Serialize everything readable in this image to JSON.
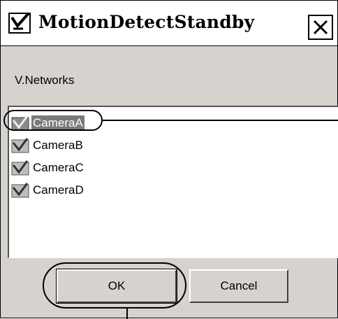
{
  "window": {
    "title": "MotionDetectStandby"
  },
  "section_label": "V.Networks",
  "cameras": [
    {
      "label": "CameraA",
      "selected": true
    },
    {
      "label": "CameraB",
      "selected": false
    },
    {
      "label": "CameraC",
      "selected": false
    },
    {
      "label": "CameraD",
      "selected": false
    }
  ],
  "buttons": {
    "ok": "OK",
    "cancel": "Cancel"
  },
  "icons": {
    "app": "checkmark-camera-icon",
    "close": "close-icon",
    "camera": "camera-icon"
  }
}
